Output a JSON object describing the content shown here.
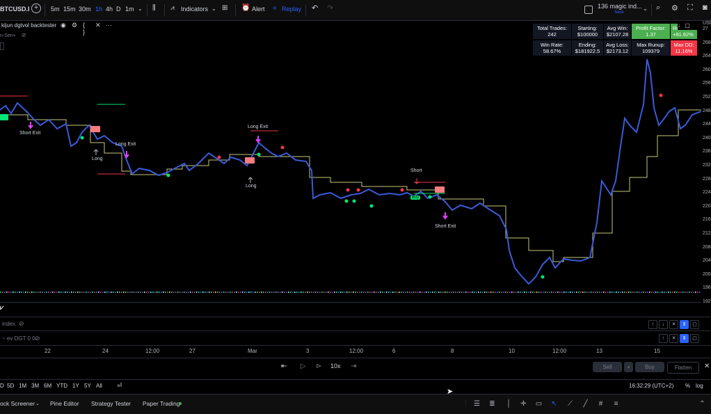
{
  "toolbar": {
    "symbol": "BTCUSD.I",
    "add_symbol": "+",
    "intervals": [
      "5m",
      "15m",
      "30m",
      "1h",
      "4h",
      "D",
      "1m"
    ],
    "active_interval_index": 3,
    "indicators_label": "Indicators",
    "alert_label": "Alert",
    "replay_label": "Replay",
    "layout_name": "136 magic ind...",
    "layout_save": "Save"
  },
  "strategy": {
    "name": "kijun dgtvol backtester",
    "sub_label": "n-Sen+"
  },
  "stats": [
    {
      "title": "Total Trades:",
      "value": "242",
      "color": "#131722"
    },
    {
      "title": "Starting:",
      "value": "$100000",
      "color": "#131722"
    },
    {
      "title": "Avg Win:",
      "value": "$2107.28",
      "color": "#131722"
    },
    {
      "title": "Profit Factor:",
      "value": "1.37",
      "color": "#4caf50"
    },
    {
      "title": "Re",
      "value": "+81.92%",
      "color": "#4caf50"
    },
    {
      "title": "Win Rate:",
      "value": "58.67%",
      "color": "#131722"
    },
    {
      "title": "Ending:",
      "value": "$181922.5",
      "color": "#131722"
    },
    {
      "title": "Avg Loss:",
      "value": "$2173.12",
      "color": "#131722"
    },
    {
      "title": "Max Runup:",
      "value": "109379",
      "color": "#131722"
    },
    {
      "title": "Max DD:",
      "value": "11.16%",
      "color": "#f23645"
    }
  ],
  "price_axis": [
    "USD",
    "27",
    "268",
    "264",
    "260",
    "256",
    "252",
    "248",
    "244",
    "240",
    "236",
    "232",
    "228",
    "224",
    "220",
    "216",
    "212",
    "208",
    "204",
    "200",
    "196",
    "192"
  ],
  "chart_labels": {
    "short_exit_1": "Short Exit",
    "long_1": "Long",
    "long_exit_1": "Long Exit",
    "long_exit_2": "Long Exit",
    "long_2": "Long",
    "short_1": "Short",
    "short_exit_2": "Short Exit",
    "buy_1": "Buy"
  },
  "panes": [
    {
      "label": "index"
    },
    {
      "label": "~ ev DGT 0 0"
    }
  ],
  "time_axis": [
    "22",
    "24",
    "12:00",
    "27",
    "Mar",
    "3",
    "12:00",
    "6",
    "8",
    "10",
    "12:00",
    "13",
    "15"
  ],
  "replay": {
    "speed": "10x",
    "sell_label": "Sell",
    "buy_label": "Buy",
    "flatten_label": "Flatten"
  },
  "ranges": [
    "D",
    "5D",
    "1M",
    "3M",
    "6M",
    "YTD",
    "1Y",
    "5Y",
    "All"
  ],
  "clock": "16:32:29 (UTC+2)",
  "percent_label": "%",
  "log_label": "log",
  "bottom_tabs": [
    "ock Screener",
    "Pine Editor",
    "Strategy Tester",
    "Paper Trading"
  ],
  "colors": {
    "background": "#000000",
    "candle": "#2962ff",
    "kijun": "#c8c87a",
    "buy_dot": "#00e676",
    "sell_dot": "#f23645",
    "signal": "#e040fb"
  }
}
